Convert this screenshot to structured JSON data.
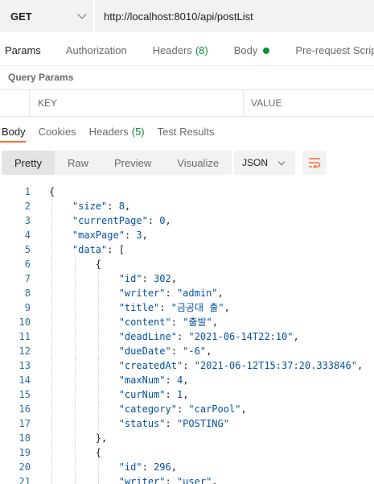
{
  "request": {
    "method": "GET",
    "url": "http://localhost:8010/api/postList"
  },
  "request_tabs": [
    {
      "label": "Params",
      "count": "",
      "active": true
    },
    {
      "label": "Authorization",
      "count": "",
      "active": false
    },
    {
      "label": "Headers",
      "count": "(8)",
      "active": false
    },
    {
      "label": "Body",
      "count": "",
      "active": false,
      "dot": true
    },
    {
      "label": "Pre-request Script",
      "count": "",
      "active": false
    }
  ],
  "query_params": {
    "title": "Query Params",
    "key_header": "KEY",
    "value_header": "VALUE"
  },
  "response_tabs": [
    {
      "label": "Body",
      "count": "",
      "active": true
    },
    {
      "label": "Cookies",
      "count": "",
      "active": false
    },
    {
      "label": "Headers",
      "count": "(5)",
      "active": false
    },
    {
      "label": "Test Results",
      "count": "",
      "active": false
    }
  ],
  "format_buttons": [
    "Pretty",
    "Raw",
    "Preview",
    "Visualize"
  ],
  "active_format": "Pretty",
  "language": "JSON",
  "colors": {
    "accent": "#ff6c37",
    "green": "#0d8f3c",
    "line_number": "#2b6ea3",
    "code": "#0451a5"
  },
  "code_lines": [
    {
      "n": "1",
      "text": "{"
    },
    {
      "n": "2",
      "text": "    \"size\": 8,"
    },
    {
      "n": "3",
      "text": "    \"currentPage\": 0,"
    },
    {
      "n": "4",
      "text": "    \"maxPage\": 3,"
    },
    {
      "n": "5",
      "text": "    \"data\": ["
    },
    {
      "n": "6",
      "text": "        {"
    },
    {
      "n": "7",
      "text": "            \"id\": 302,"
    },
    {
      "n": "8",
      "text": "            \"writer\": \"admin\","
    },
    {
      "n": "9",
      "text": "            \"title\": \"금공대 출\","
    },
    {
      "n": "10",
      "text": "            \"content\": \"출발\","
    },
    {
      "n": "11",
      "text": "            \"deadLine\": \"2021-06-14T22:10\","
    },
    {
      "n": "12",
      "text": "            \"dueDate\": \"-6\","
    },
    {
      "n": "13",
      "text": "            \"createdAt\": \"2021-06-12T15:37:20.333846\","
    },
    {
      "n": "14",
      "text": "            \"maxNum\": 4,"
    },
    {
      "n": "15",
      "text": "            \"curNum\": 1,"
    },
    {
      "n": "16",
      "text": "            \"category\": \"carPool\","
    },
    {
      "n": "17",
      "text": "            \"status\": \"POSTING\""
    },
    {
      "n": "18",
      "text": "        },"
    },
    {
      "n": "19",
      "text": "        {"
    },
    {
      "n": "20",
      "text": "            \"id\": 296,"
    },
    {
      "n": "21",
      "text": "            \"writer\": \"user\","
    }
  ]
}
